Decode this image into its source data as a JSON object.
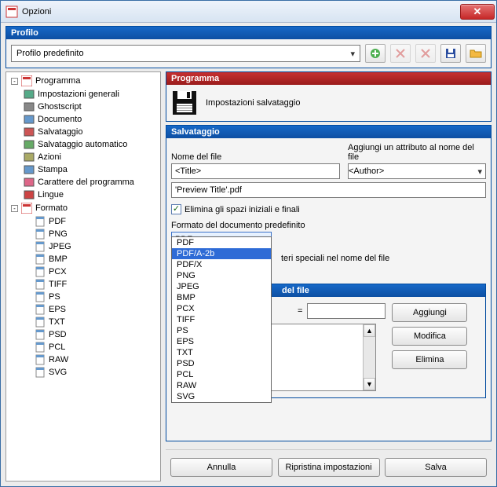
{
  "window": {
    "title": "Opzioni"
  },
  "profilo": {
    "header": "Profilo",
    "selected": "Profilo predefinito",
    "tools": {
      "add": "add-profile-icon",
      "remove1": "delete-profile-icon",
      "remove2": "delete-profile-2-icon",
      "save": "save-profile-icon",
      "open": "open-folder-icon"
    }
  },
  "tree": {
    "programma": {
      "label": "Programma",
      "items": [
        "Impostazioni generali",
        "Ghostscript",
        "Documento",
        "Salvataggio",
        "Salvataggio automatico",
        "Azioni",
        "Stampa",
        "Carattere del programma",
        "Lingue"
      ]
    },
    "formato": {
      "label": "Formato",
      "items": [
        "PDF",
        "PNG",
        "JPEG",
        "BMP",
        "PCX",
        "TIFF",
        "PS",
        "EPS",
        "TXT",
        "PSD",
        "PCL",
        "RAW",
        "SVG"
      ]
    }
  },
  "right": {
    "programma": {
      "header": "Programma",
      "desc": "Impostazioni salvataggio"
    },
    "salvataggio": {
      "header": "Salvataggio",
      "nome_label": "Nome del file",
      "nome_value": "<Title>",
      "attr_label": "Aggiungi un attributo al nome del file",
      "attr_value": "<Author>",
      "preview": "'Preview Title'.pdf",
      "trim_label": "Elimina gli spazi iniziali e finali",
      "format_label": "Formato del documento predefinito",
      "format_value": "PDF",
      "format_options": [
        "PDF",
        "PDF/A-2b",
        "PDF/X",
        "PNG",
        "JPEG",
        "BMP",
        "PCX",
        "TIFF",
        "PS",
        "EPS",
        "TXT",
        "PSD",
        "PCL",
        "RAW",
        "SVG"
      ],
      "format_selected_index": 1,
      "behind_text": "teri speciali nel nome del file"
    },
    "sost": {
      "header_visible": "del file",
      "eq": "=",
      "buttons": {
        "add": "Aggiungi",
        "edit": "Modifica",
        "del": "Elimina"
      }
    }
  },
  "bottom": {
    "cancel": "Annulla",
    "reset": "Ripristina impostazioni",
    "save": "Salva"
  }
}
